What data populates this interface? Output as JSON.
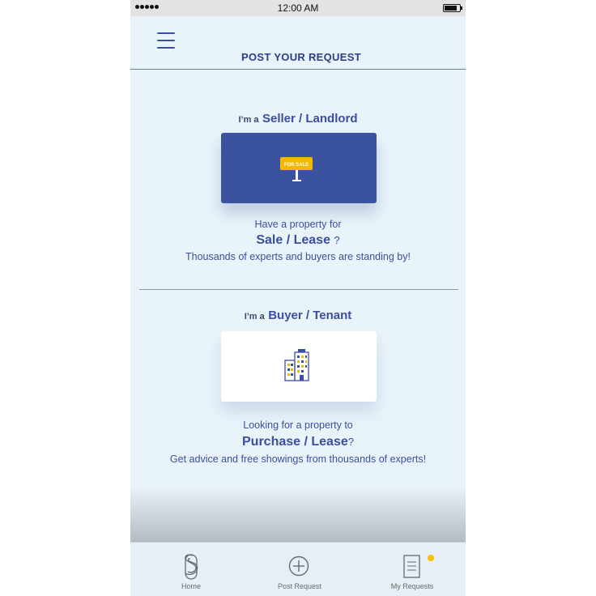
{
  "status_bar": {
    "time": "12:00 AM"
  },
  "header": {
    "title": "POST YOUR REQUEST",
    "menu_icon": "hamburger-menu-icon"
  },
  "seller": {
    "prefix": "I’m a",
    "role": "Seller / Landlord",
    "sign_text": "FOR SALE",
    "line1": "Have a property for",
    "line2": "Sale / Lease",
    "line2_suffix": "?",
    "line3": "Thousands of experts and buyers are standing by!"
  },
  "buyer": {
    "prefix": "I’m a",
    "role": "Buyer / Tenant",
    "line1": "Looking for a property to",
    "line2": "Purchase / Lease",
    "line2_suffix": "?",
    "line3": "Get advice and free showings from thousands of experts!"
  },
  "tabbar": {
    "items": [
      {
        "label": "Home",
        "icon": "home-logo-icon"
      },
      {
        "label": "Post Request",
        "icon": "add-circle-icon"
      },
      {
        "label": "My Requests",
        "icon": "document-icon"
      }
    ],
    "notification_color": "#f9c200"
  },
  "colors": {
    "accent": "#3b529e",
    "background": "#e9f3fa"
  }
}
